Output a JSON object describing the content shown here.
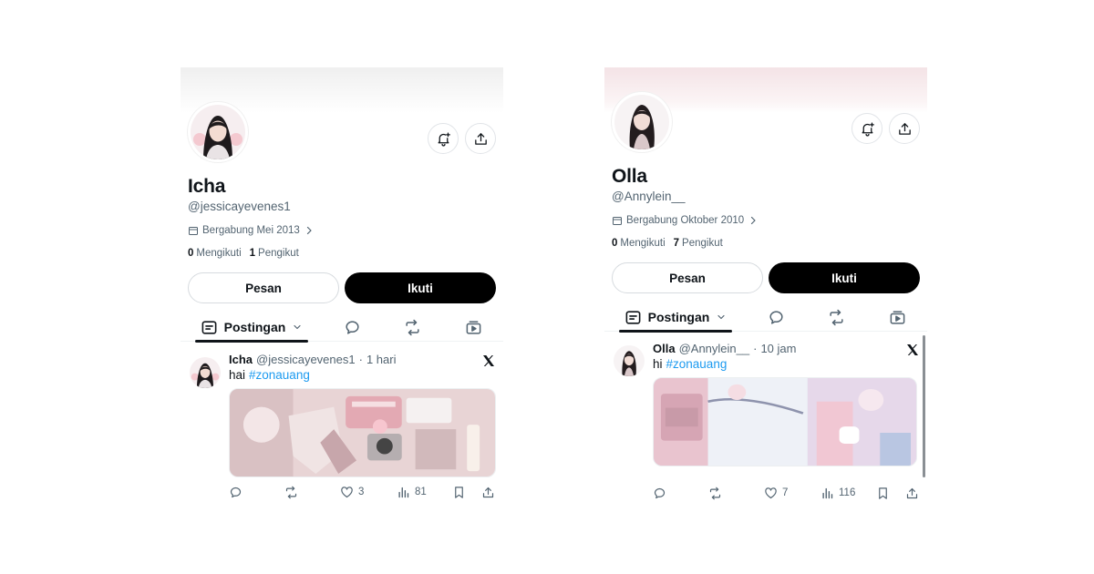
{
  "icons": {
    "notify": "bell-plus-icon",
    "share": "share-icon",
    "calendar": "calendar-icon",
    "chevron": "chevron-right-icon",
    "posts_tab": "posts-icon",
    "replies_tab": "speech-bubble-icon",
    "reposts_tab": "repost-icon",
    "media_tab": "media-icon",
    "x": "x-logo",
    "reply": "reply-icon",
    "repost": "repost-icon",
    "like": "heart-icon",
    "views": "views-icon",
    "bookmark": "bookmark-icon"
  },
  "colors": {
    "text": "#0f1419",
    "secondary": "#536471",
    "hashtag": "#1d9bf0",
    "follow_button": "#000000"
  },
  "profiles": [
    {
      "name": "Icha",
      "handle": "@jessicayevenes1",
      "joined": "Bergabung Mei 2013",
      "following_count": "0",
      "following_label": "Mengikuti",
      "followers_count": "1",
      "followers_label": "Pengikut",
      "message_button": "Pesan",
      "follow_button": "Ikuti",
      "tab_label": "Postingan",
      "post": {
        "name": "Icha",
        "handle": "@jessicayevenes1",
        "separator": "·",
        "time": "1 hari",
        "text": "hai",
        "hashtag": "#zonauang",
        "replies": "",
        "reposts": "",
        "likes": "3",
        "views": "81"
      }
    },
    {
      "name": "Olla",
      "handle": "@Annylein__",
      "joined": "Bergabung Oktober 2010",
      "following_count": "0",
      "following_label": "Mengikuti",
      "followers_count": "7",
      "followers_label": "Pengikut",
      "message_button": "Pesan",
      "follow_button": "Ikuti",
      "tab_label": "Postingan",
      "post": {
        "name": "Olla",
        "handle": "@Annylein__",
        "separator": "·",
        "time": "10 jam",
        "text": "hi",
        "hashtag": "#zonauang",
        "replies": "",
        "reposts": "",
        "likes": "7",
        "views": "116"
      }
    }
  ]
}
